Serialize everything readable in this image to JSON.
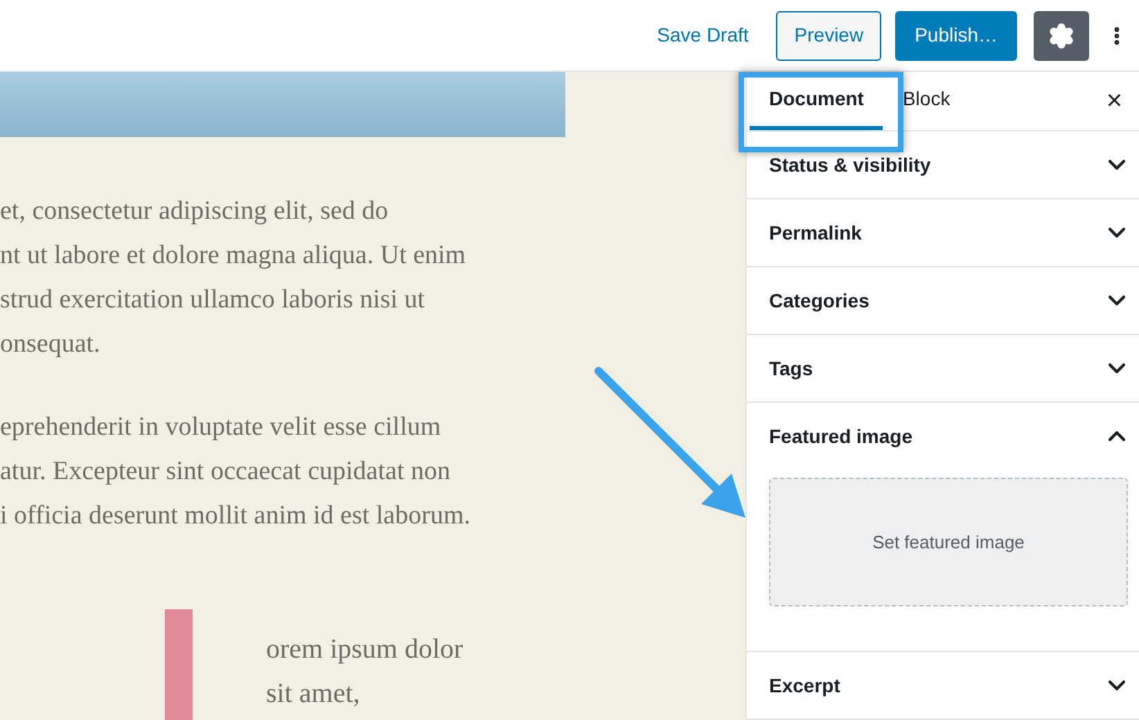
{
  "toolbar": {
    "save_draft": "Save Draft",
    "preview": "Preview",
    "publish": "Publish…"
  },
  "editor": {
    "paragraphs": [
      [
        "et, consectetur adipiscing elit, sed do",
        "nt ut labore et dolore magna aliqua. Ut enim",
        "strud exercitation ullamco laboris nisi ut",
        "onsequat."
      ],
      [
        "eprehenderit in voluptate velit esse cillum",
        "atur. Excepteur sint occaecat cupidatat non",
        "i officia deserunt mollit anim id est laborum."
      ]
    ],
    "quote_lines": [
      "orem ipsum dolor",
      "sit amet,"
    ]
  },
  "sidebar": {
    "tabs": [
      {
        "label": "Document",
        "selected": true
      },
      {
        "label": "Block",
        "selected": false
      }
    ],
    "close": "×",
    "panels": [
      {
        "title": "Status & visibility",
        "expanded": false
      },
      {
        "title": "Permalink",
        "expanded": false
      },
      {
        "title": "Categories",
        "expanded": false
      },
      {
        "title": "Tags",
        "expanded": false
      },
      {
        "title": "Featured image",
        "expanded": true,
        "button": "Set featured image"
      },
      {
        "title": "Excerpt",
        "expanded": false
      }
    ]
  }
}
